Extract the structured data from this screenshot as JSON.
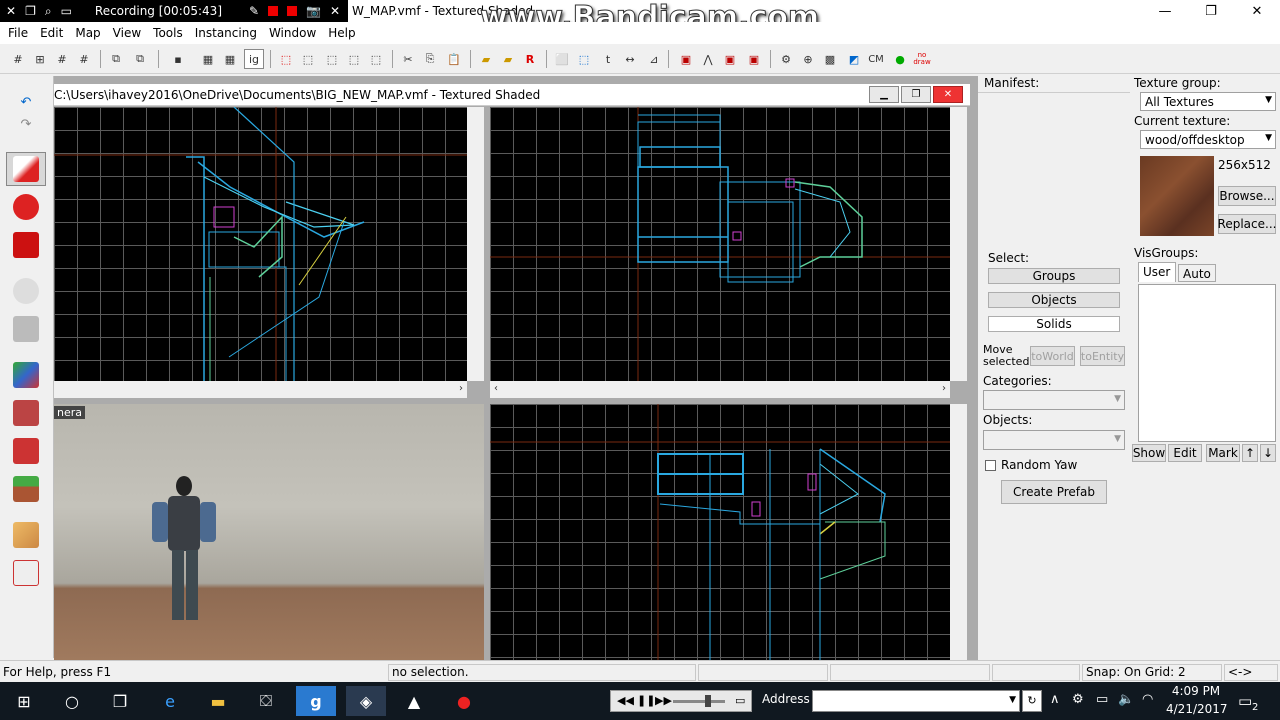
{
  "recording": {
    "label": "Recording [00:05:43]"
  },
  "window": {
    "title_partial": "W_MAP.vmf - Textured Shaded"
  },
  "watermark": "www.Bandicam.com",
  "menu": [
    "File",
    "Edit",
    "Map",
    "View",
    "Tools",
    "Instancing",
    "Window",
    "Help"
  ],
  "mdi": {
    "title": "C:\\Users\\ihavey2016\\OneDrive\\Documents\\BIG_NEW_MAP.vmf - Textured Shaded",
    "camera_label": "nera"
  },
  "toolbar": {
    "ig": "ig",
    "cm": "CM",
    "nodraw": "no draw",
    "r": "R"
  },
  "right": {
    "manifest": "Manifest:",
    "texture_group_label": "Texture group:",
    "texture_group_value": "All Textures",
    "current_texture_label": "Current texture:",
    "current_texture_value": "wood/offdesktop",
    "texture_size": "256x512",
    "browse": "Browse...",
    "replace": "Replace...",
    "select_label": "Select:",
    "groups": "Groups",
    "objects": "Objects",
    "solids": "Solids",
    "visgroups_label": "VisGroups:",
    "tab_user": "User",
    "tab_auto": "Auto",
    "move_selected": "Move selected:",
    "to_world": "toWorld",
    "to_entity": "toEntity",
    "categories_label": "Categories:",
    "objects_label": "Objects:",
    "show": "Show",
    "edit": "Edit",
    "mark": "Mark",
    "random_yaw": "Random Yaw",
    "create_prefab": "Create Prefab"
  },
  "status": {
    "help": "For Help, press F1",
    "selection": "no selection.",
    "snap": "Snap: On Grid: 2",
    "arrows": "<->"
  },
  "taskbar": {
    "address_label": "Address",
    "time": "4:09 PM",
    "date": "4/21/2017",
    "notifications": "2"
  }
}
